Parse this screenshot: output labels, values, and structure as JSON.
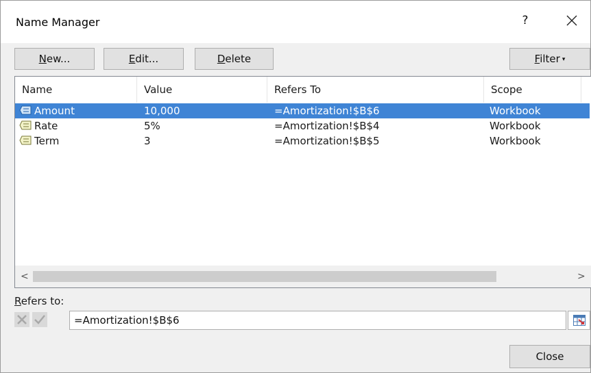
{
  "window": {
    "title": "Name Manager",
    "help_label": "?",
    "close_icon": "close-icon"
  },
  "toolbar": {
    "new_label": {
      "ul": "N",
      "rest": "ew..."
    },
    "edit_label": {
      "ul": "E",
      "rest": "dit..."
    },
    "delete_label": {
      "ul": "D",
      "rest": "elete"
    },
    "filter_label": {
      "ul": "F",
      "rest": "ilter"
    },
    "filter_caret": "▾"
  },
  "list": {
    "columns": [
      "Name",
      "Value",
      "Refers To",
      "Scope"
    ],
    "rows": [
      {
        "name": "Amount",
        "value": "10,000",
        "refers_to": "=Amortization!$B$6",
        "scope": "Workbook",
        "selected": true
      },
      {
        "name": "Rate",
        "value": "5%",
        "refers_to": "=Amortization!$B$4",
        "scope": "Workbook",
        "selected": false
      },
      {
        "name": "Term",
        "value": "3",
        "refers_to": "=Amortization!$B$5",
        "scope": "Workbook",
        "selected": false
      }
    ],
    "scroll_left_glyph": "<",
    "scroll_right_glyph": ">"
  },
  "refers": {
    "label": {
      "ul": "R",
      "rest": "efers to:"
    },
    "value": "=Amortization!$B$6"
  },
  "footer": {
    "close_label": "Close"
  },
  "colors": {
    "selection": "#3f84d5",
    "dialog_bg": "#f0f0f0"
  }
}
